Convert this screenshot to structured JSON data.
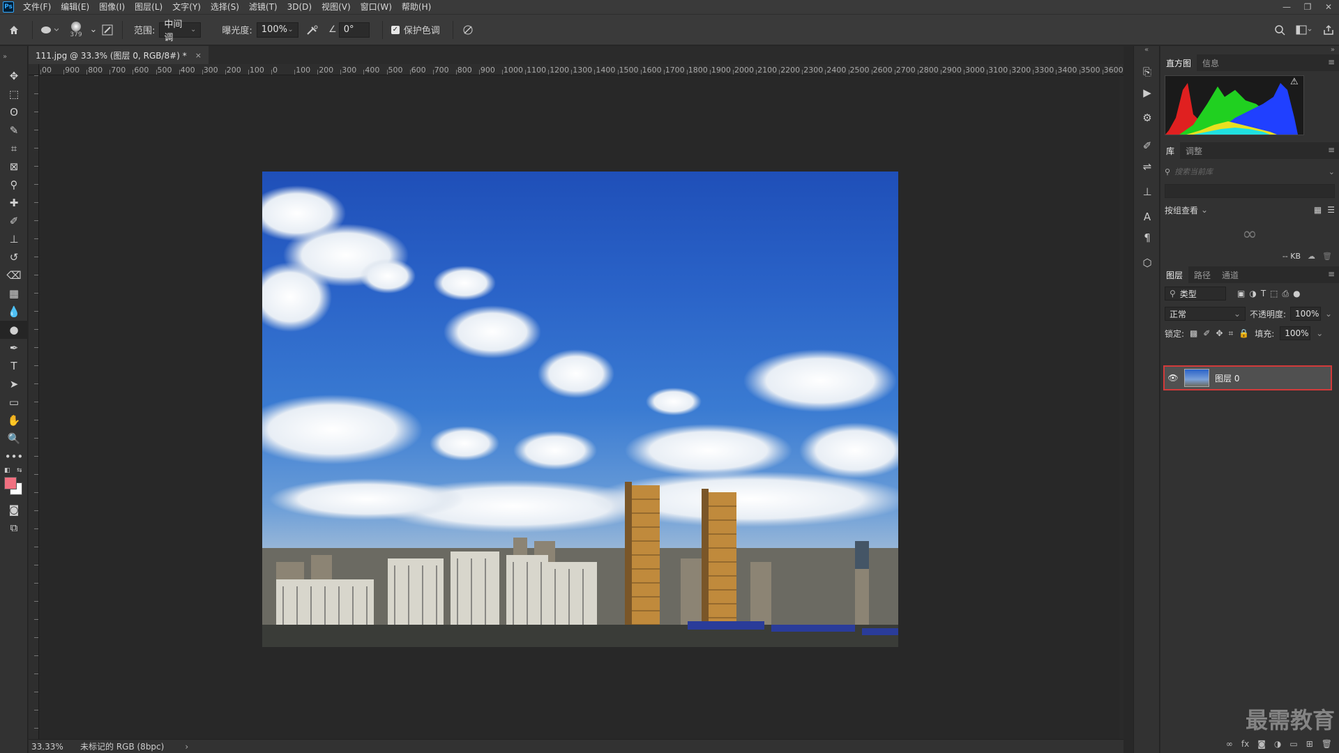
{
  "app": {
    "logo": "Ps"
  },
  "menu": [
    "文件(F)",
    "编辑(E)",
    "图像(I)",
    "图层(L)",
    "文字(Y)",
    "选择(S)",
    "滤镜(T)",
    "3D(D)",
    "视图(V)",
    "窗口(W)",
    "帮助(H)"
  ],
  "options": {
    "brush_size": "379",
    "range_label": "范围:",
    "range_value": "中间调",
    "exposure_label": "曝光度:",
    "exposure_value": "100%",
    "angle_value": "0°",
    "protect_tones_label": "保护色调",
    "protect_tones_checked": true
  },
  "document": {
    "tab_title": "111.jpg @ 33.3% (图层 0, RGB/8#) *",
    "ruler_top_labels": [
      "00",
      "900",
      "800",
      "700",
      "600",
      "500",
      "400",
      "300",
      "200",
      "100",
      "0",
      "100",
      "200",
      "300",
      "400",
      "500",
      "600",
      "700",
      "800",
      "900",
      "1000",
      "1100",
      "1200",
      "1300",
      "1400",
      "1500",
      "1600",
      "1700",
      "1800",
      "1900",
      "2000",
      "2100",
      "2200",
      "2300",
      "2400",
      "2500",
      "2600",
      "2700",
      "2800",
      "2900",
      "3000",
      "3100",
      "3200",
      "3300",
      "3400",
      "3500",
      "3600"
    ]
  },
  "status": {
    "zoom": "33.33%",
    "profile": "未标记的 RGB (8bpc)"
  },
  "panels": {
    "top_tabs": [
      "直方图",
      "信息"
    ],
    "lib_tabs": [
      "库",
      "调整"
    ],
    "search_placeholder": "搜索当前库",
    "view_by": "按组查看",
    "kb": "-- KB",
    "layers_tabs": [
      "图层",
      "路径",
      "通道"
    ],
    "filter_kind": "类型",
    "blend_mode": "正常",
    "opacity_label": "不透明度:",
    "opacity_value": "100%",
    "lock_label": "锁定:",
    "fill_label": "填充:",
    "fill_value": "100%",
    "layer_name": "图层 0"
  },
  "watermark": "最需教育",
  "colors": {
    "foreground": "#f07080",
    "background": "#ffffff",
    "highlight_border": "#d23a3a"
  }
}
